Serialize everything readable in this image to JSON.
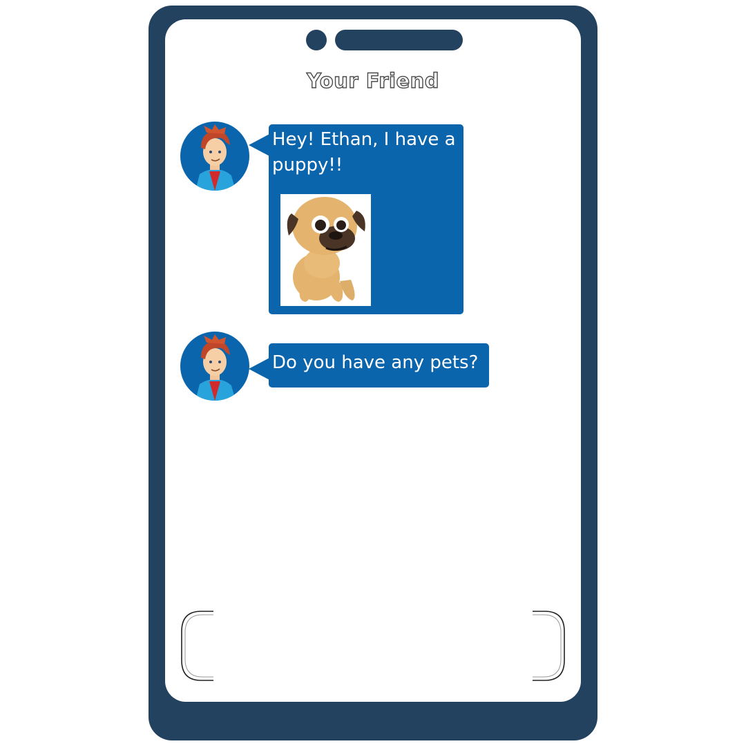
{
  "contact": {
    "name": "Your Friend"
  },
  "messages": [
    {
      "sender_avatar": "boy-avatar-icon",
      "text": "Hey! Ethan, I have a puppy!!",
      "image": "pug-puppy-image"
    },
    {
      "sender_avatar": "boy-avatar-icon",
      "text": "Do you have any pets?"
    }
  ],
  "colors": {
    "phone_frame": "#23425f",
    "bubble": "#0a65ac",
    "screen": "#ffffff"
  }
}
